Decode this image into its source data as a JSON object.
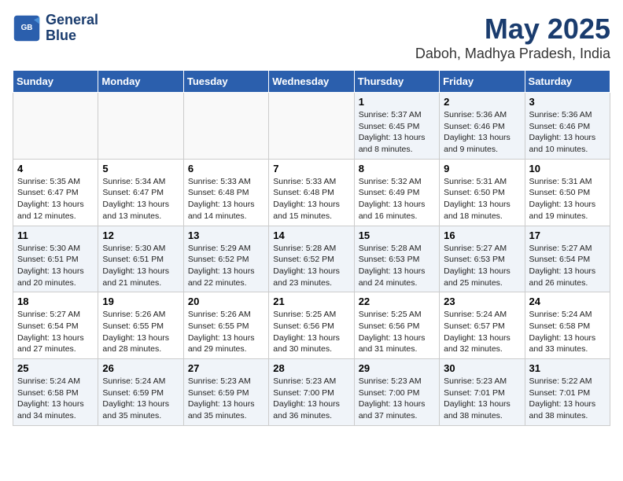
{
  "logo": {
    "line1": "General",
    "line2": "Blue"
  },
  "title": "May 2025",
  "subtitle": "Daboh, Madhya Pradesh, India",
  "days_of_week": [
    "Sunday",
    "Monday",
    "Tuesday",
    "Wednesday",
    "Thursday",
    "Friday",
    "Saturday"
  ],
  "weeks": [
    [
      {
        "day": "",
        "info": ""
      },
      {
        "day": "",
        "info": ""
      },
      {
        "day": "",
        "info": ""
      },
      {
        "day": "",
        "info": ""
      },
      {
        "day": "1",
        "info": "Sunrise: 5:37 AM\nSunset: 6:45 PM\nDaylight: 13 hours and 8 minutes."
      },
      {
        "day": "2",
        "info": "Sunrise: 5:36 AM\nSunset: 6:46 PM\nDaylight: 13 hours and 9 minutes."
      },
      {
        "day": "3",
        "info": "Sunrise: 5:36 AM\nSunset: 6:46 PM\nDaylight: 13 hours and 10 minutes."
      }
    ],
    [
      {
        "day": "4",
        "info": "Sunrise: 5:35 AM\nSunset: 6:47 PM\nDaylight: 13 hours and 12 minutes."
      },
      {
        "day": "5",
        "info": "Sunrise: 5:34 AM\nSunset: 6:47 PM\nDaylight: 13 hours and 13 minutes."
      },
      {
        "day": "6",
        "info": "Sunrise: 5:33 AM\nSunset: 6:48 PM\nDaylight: 13 hours and 14 minutes."
      },
      {
        "day": "7",
        "info": "Sunrise: 5:33 AM\nSunset: 6:48 PM\nDaylight: 13 hours and 15 minutes."
      },
      {
        "day": "8",
        "info": "Sunrise: 5:32 AM\nSunset: 6:49 PM\nDaylight: 13 hours and 16 minutes."
      },
      {
        "day": "9",
        "info": "Sunrise: 5:31 AM\nSunset: 6:50 PM\nDaylight: 13 hours and 18 minutes."
      },
      {
        "day": "10",
        "info": "Sunrise: 5:31 AM\nSunset: 6:50 PM\nDaylight: 13 hours and 19 minutes."
      }
    ],
    [
      {
        "day": "11",
        "info": "Sunrise: 5:30 AM\nSunset: 6:51 PM\nDaylight: 13 hours and 20 minutes."
      },
      {
        "day": "12",
        "info": "Sunrise: 5:30 AM\nSunset: 6:51 PM\nDaylight: 13 hours and 21 minutes."
      },
      {
        "day": "13",
        "info": "Sunrise: 5:29 AM\nSunset: 6:52 PM\nDaylight: 13 hours and 22 minutes."
      },
      {
        "day": "14",
        "info": "Sunrise: 5:28 AM\nSunset: 6:52 PM\nDaylight: 13 hours and 23 minutes."
      },
      {
        "day": "15",
        "info": "Sunrise: 5:28 AM\nSunset: 6:53 PM\nDaylight: 13 hours and 24 minutes."
      },
      {
        "day": "16",
        "info": "Sunrise: 5:27 AM\nSunset: 6:53 PM\nDaylight: 13 hours and 25 minutes."
      },
      {
        "day": "17",
        "info": "Sunrise: 5:27 AM\nSunset: 6:54 PM\nDaylight: 13 hours and 26 minutes."
      }
    ],
    [
      {
        "day": "18",
        "info": "Sunrise: 5:27 AM\nSunset: 6:54 PM\nDaylight: 13 hours and 27 minutes."
      },
      {
        "day": "19",
        "info": "Sunrise: 5:26 AM\nSunset: 6:55 PM\nDaylight: 13 hours and 28 minutes."
      },
      {
        "day": "20",
        "info": "Sunrise: 5:26 AM\nSunset: 6:55 PM\nDaylight: 13 hours and 29 minutes."
      },
      {
        "day": "21",
        "info": "Sunrise: 5:25 AM\nSunset: 6:56 PM\nDaylight: 13 hours and 30 minutes."
      },
      {
        "day": "22",
        "info": "Sunrise: 5:25 AM\nSunset: 6:56 PM\nDaylight: 13 hours and 31 minutes."
      },
      {
        "day": "23",
        "info": "Sunrise: 5:24 AM\nSunset: 6:57 PM\nDaylight: 13 hours and 32 minutes."
      },
      {
        "day": "24",
        "info": "Sunrise: 5:24 AM\nSunset: 6:58 PM\nDaylight: 13 hours and 33 minutes."
      }
    ],
    [
      {
        "day": "25",
        "info": "Sunrise: 5:24 AM\nSunset: 6:58 PM\nDaylight: 13 hours and 34 minutes."
      },
      {
        "day": "26",
        "info": "Sunrise: 5:24 AM\nSunset: 6:59 PM\nDaylight: 13 hours and 35 minutes."
      },
      {
        "day": "27",
        "info": "Sunrise: 5:23 AM\nSunset: 6:59 PM\nDaylight: 13 hours and 35 minutes."
      },
      {
        "day": "28",
        "info": "Sunrise: 5:23 AM\nSunset: 7:00 PM\nDaylight: 13 hours and 36 minutes."
      },
      {
        "day": "29",
        "info": "Sunrise: 5:23 AM\nSunset: 7:00 PM\nDaylight: 13 hours and 37 minutes."
      },
      {
        "day": "30",
        "info": "Sunrise: 5:23 AM\nSunset: 7:01 PM\nDaylight: 13 hours and 38 minutes."
      },
      {
        "day": "31",
        "info": "Sunrise: 5:22 AM\nSunset: 7:01 PM\nDaylight: 13 hours and 38 minutes."
      }
    ]
  ]
}
